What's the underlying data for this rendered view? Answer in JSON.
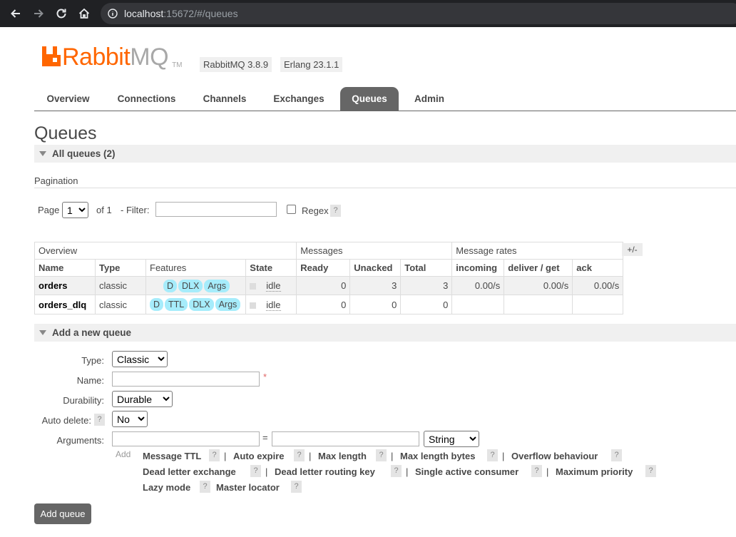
{
  "browser": {
    "url_host": "localhost",
    "url_rest": ":15672/#/queues"
  },
  "header": {
    "logo_part1": "Rabbit",
    "logo_part2": "MQ",
    "logo_tm": "TM",
    "version_rabbit": "RabbitMQ 3.8.9",
    "version_erlang": "Erlang 23.1.1",
    "brand_color": "#ff6600"
  },
  "tabs": [
    {
      "label": "Overview",
      "active": false
    },
    {
      "label": "Connections",
      "active": false
    },
    {
      "label": "Channels",
      "active": false
    },
    {
      "label": "Exchanges",
      "active": false
    },
    {
      "label": "Queues",
      "active": true
    },
    {
      "label": "Admin",
      "active": false
    }
  ],
  "page_title": "Queues",
  "all_queues_section": "All queues (2)",
  "pagination": {
    "title": "Pagination",
    "page_label": "Page",
    "page_value": "1",
    "of_label": "of 1",
    "filter_label": "- Filter:",
    "filter_value": "",
    "regex_label": "Regex",
    "help": "?"
  },
  "table": {
    "group_headers": [
      "Overview",
      "Messages",
      "Message rates"
    ],
    "toggle": "+/-",
    "columns": [
      "Name",
      "Type",
      "Features",
      "State",
      "Ready",
      "Unacked",
      "Total",
      "incoming",
      "deliver / get",
      "ack"
    ],
    "rows": [
      {
        "name": "orders",
        "type": "classic",
        "features": [
          "D",
          "DLX",
          "Args"
        ],
        "state": "idle",
        "ready": "0",
        "unacked": "3",
        "total": "3",
        "incoming": "0.00/s",
        "deliver_get": "0.00/s",
        "ack": "0.00/s"
      },
      {
        "name": "orders_dlq",
        "type": "classic",
        "features": [
          "D",
          "TTL",
          "DLX",
          "Args"
        ],
        "state": "idle",
        "ready": "0",
        "unacked": "0",
        "total": "0",
        "incoming": "",
        "deliver_get": "",
        "ack": ""
      }
    ]
  },
  "add_queue": {
    "section": "Add a new queue",
    "type_label": "Type:",
    "type_value": "Classic",
    "name_label": "Name:",
    "name_value": "",
    "required_mark": "*",
    "durability_label": "Durability:",
    "durability_value": "Durable",
    "auto_delete_label": "Auto delete:",
    "auto_delete_value": "No",
    "arguments_label": "Arguments:",
    "equals": "=",
    "arg_type_value": "String",
    "add_label": "Add",
    "arg_links": [
      "Message TTL",
      "Auto expire",
      "Max length",
      "Max length bytes",
      "Overflow behaviour",
      "Dead letter exchange",
      "Dead letter routing key",
      "Single active consumer",
      "Maximum priority",
      "Lazy mode",
      "Master locator"
    ],
    "separator": "|",
    "submit_label": "Add queue"
  }
}
